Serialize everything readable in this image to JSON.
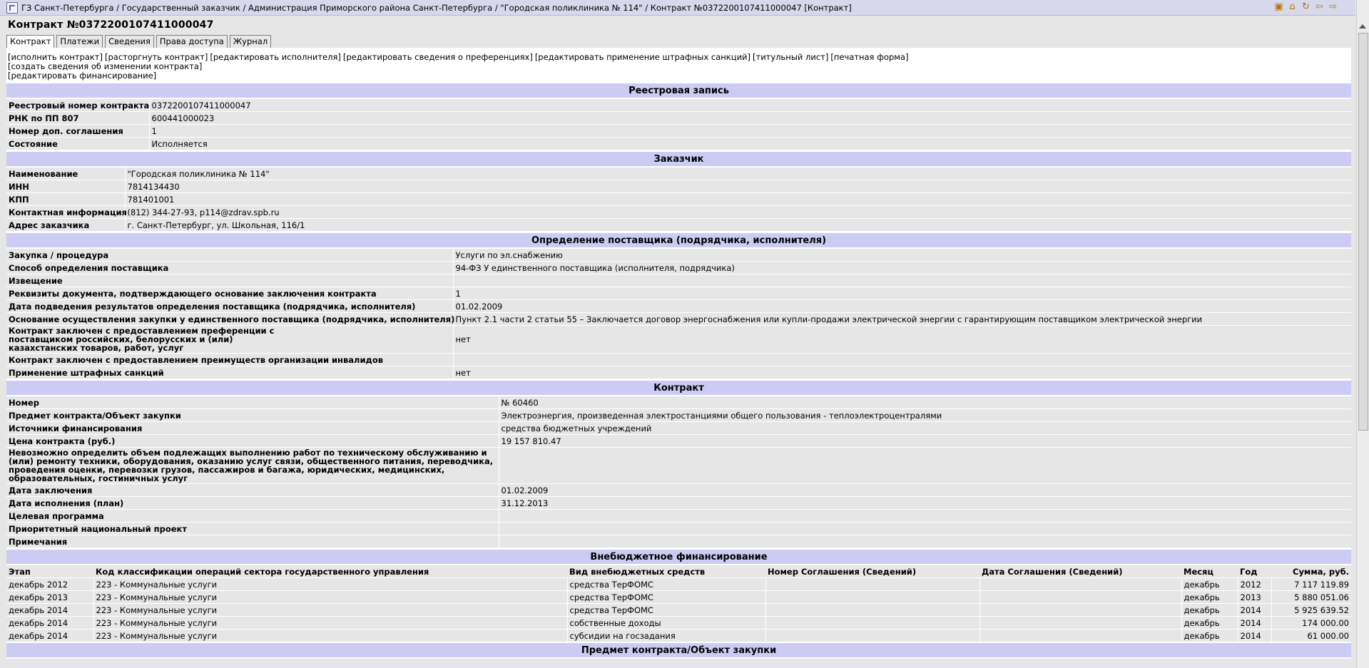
{
  "breadcrumb": "ГЗ Санкт-Петербурга / Государственный заказчик / Администрация Приморского района Санкт-Петербурга / \"Городская поликлиника № 114\" / Контракт №0372200107411000047 [Контракт]",
  "page_title": "Контракт №0372200107411000047",
  "tabs": [
    "Контракт",
    "Платежи",
    "Сведения",
    "Права доступа",
    "Журнал"
  ],
  "actions": {
    "line1": [
      "[исполнить контракт]",
      "[расторгнуть контракт]",
      "[редактировать исполнителя]",
      "[редактировать сведения о преференциях]",
      "[редактировать применение штрафных санкций]",
      "[титульный лист]",
      "[печатная форма]"
    ],
    "line2": [
      "[создать сведения об изменении контракта]"
    ],
    "line3": [
      "[редактировать финансирование]"
    ]
  },
  "registry": {
    "title": "Реестровая запись",
    "rows": [
      {
        "label": "Реестровый номер контракта",
        "value": "0372200107411000047"
      },
      {
        "label": "РНК по ПП 807",
        "value": "600441000023"
      },
      {
        "label": "Номер доп. соглашения",
        "value": "1"
      },
      {
        "label": "Состояние",
        "value": "Исполняется"
      }
    ]
  },
  "customer": {
    "title": "Заказчик",
    "rows": [
      {
        "label": "Наименование",
        "value": "\"Городская поликлиника № 114\""
      },
      {
        "label": "ИНН",
        "value": "7814134430"
      },
      {
        "label": "КПП",
        "value": "781401001"
      },
      {
        "label": "Контактная информация",
        "value": "(812) 344-27-93, p114@zdrav.spb.ru"
      },
      {
        "label": "Адрес заказчика",
        "value": "г. Санкт-Петербург, ул. Школьная, 116/1"
      }
    ]
  },
  "supplier": {
    "title": "Определение поставщика (подрядчика, исполнителя)",
    "rows": [
      {
        "label": "Закупка / процедура",
        "value": "Услуги по эл.снабжению"
      },
      {
        "label": "Способ определения поставщика",
        "value": "94-ФЗ У единственного поставщика (исполнителя, подрядчика)"
      },
      {
        "label": "Извещение",
        "value": ""
      },
      {
        "label": "Реквизиты документа, подтверждающего основание заключения контракта",
        "value": "1"
      },
      {
        "label": "Дата подведения результатов определения поставщика (подрядчика, исполнителя)",
        "value": "01.02.2009"
      },
      {
        "label": "Основание осуществления закупки у единственного поставщика (подрядчика, исполнителя)",
        "value": "Пункт 2.1 части 2 статьи 55 – Заключается договор энергоснабжения или купли-продажи электрической энергии с гарантирующим поставщиком электрической энергии"
      },
      {
        "label": "Контракт заключен с предоставлением преференции с поставщиком российских, белорусских и (или) казахстанских товаров, работ, услуг",
        "value": "нет"
      },
      {
        "label": "Контракт заключен с предоставлением преимуществ организации инвалидов",
        "value": ""
      },
      {
        "label": "Применение штрафных санкций",
        "value": "нет"
      }
    ]
  },
  "contract": {
    "title": "Контракт",
    "rows": [
      {
        "label": "Номер",
        "value": "№ 60460"
      },
      {
        "label": "Предмет контракта/Объект закупки",
        "value": "Электроэнергия, произведенная электростанциями общего пользования - теплоэлектроцентралями"
      },
      {
        "label": "Источники финансирования",
        "value": "средства бюджетных учреждений"
      },
      {
        "label": "Цена контракта (руб.)",
        "value": "19 157 810.47"
      },
      {
        "label": "Невозможно определить объем подлежащих выполнению работ по техническому обслуживанию и (или) ремонту техники, оборудования, оказанию услуг связи, общественного питания, переводчика, проведения оценки, перевозки грузов, пассажиров и багажа, юридических, медицинских, образовательных, гостиничных услуг",
        "value": ""
      },
      {
        "label": "Дата заключения",
        "value": "01.02.2009"
      },
      {
        "label": "Дата исполнения (план)",
        "value": "31.12.2013"
      },
      {
        "label": "Целевая программа",
        "value": ""
      },
      {
        "label": "Приоритетный национальный проект",
        "value": ""
      },
      {
        "label": "Примечания",
        "value": ""
      }
    ]
  },
  "financing": {
    "title": "Внебюджетное финансирование",
    "columns": [
      "Этап",
      "Код классификации операций сектора государственного управления",
      "Вид внебюджетных средств",
      "Номер Соглашения (Сведений)",
      "Дата Соглашения (Сведений)",
      "Месяц",
      "Год",
      "Сумма, руб."
    ],
    "rows": [
      [
        "декабрь 2012",
        "223 - Коммунальные услуги",
        "средства ТерФОМС",
        "",
        "",
        "декабрь",
        "2012",
        "7 117 119.89"
      ],
      [
        "декабрь 2013",
        "223 - Коммунальные услуги",
        "средства ТерФОМС",
        "",
        "",
        "декабрь",
        "2013",
        "5 880 051.06"
      ],
      [
        "декабрь 2014",
        "223 - Коммунальные услуги",
        "средства ТерФОМС",
        "",
        "",
        "декабрь",
        "2014",
        "5 925 639.52"
      ],
      [
        "декабрь 2014",
        "223 - Коммунальные услуги",
        "собственные доходы",
        "",
        "",
        "декабрь",
        "2014",
        "174 000.00"
      ],
      [
        "декабрь 2014",
        "223 - Коммунальные услуги",
        "субсидии на госзадания",
        "",
        "",
        "декабрь",
        "2014",
        "61 000.00"
      ]
    ]
  },
  "subject": {
    "title": "Предмет контракта/Объект закупки"
  },
  "icons": [
    "folder-icon",
    "home-icon",
    "refresh-icon",
    "back-icon",
    "forward-icon"
  ]
}
